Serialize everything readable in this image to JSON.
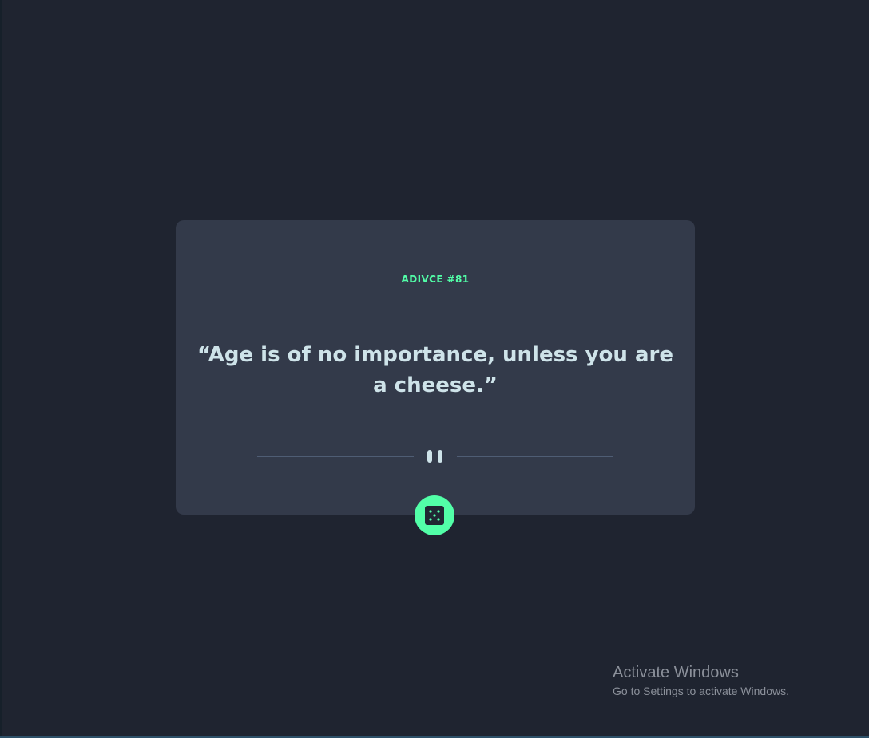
{
  "card": {
    "advice_id": "ADIVCE #81",
    "quote": "“Age is of no importance, unless you are a cheese.”"
  },
  "divider": {
    "icon": "pause-icon"
  },
  "dice_button": {
    "icon": "dice-icon"
  },
  "colors": {
    "background": "#1f2430",
    "card": "#333a4a",
    "accent": "#52ffa8",
    "text": "#cee3e9",
    "divider": "#4f5d74"
  },
  "watermark": {
    "title": "Activate Windows",
    "subtitle": "Go to Settings to activate Windows."
  }
}
